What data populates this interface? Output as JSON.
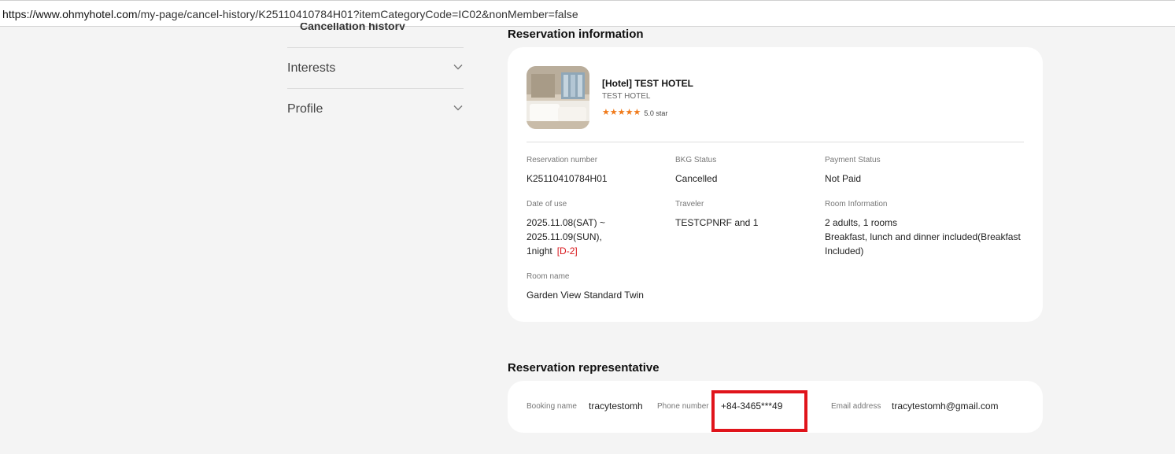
{
  "browser": {
    "url_host": "https://www.ohmyhotel.com",
    "url_path": "/my-page/cancel-history/K25110410784H01?itemCategoryCode=IC02&nonMember=false"
  },
  "sidebar": {
    "partial_item": "Cancellation history",
    "items": [
      {
        "label": "Interests",
        "icon": "chevron-down-icon"
      },
      {
        "label": "Profile",
        "icon": "chevron-down-icon"
      }
    ]
  },
  "reservation_info": {
    "title": "Reservation information",
    "hotel": {
      "name": "[Hotel] TEST HOTEL",
      "sub": "TEST HOTEL",
      "stars": 5,
      "rating": "5.0 star",
      "star_color": "#f07a1a"
    },
    "fields": {
      "reservation_number": {
        "label": "Reservation number",
        "value": "K25110410784H01"
      },
      "bkg_status": {
        "label": "BKG Status",
        "value": "Cancelled"
      },
      "payment_status": {
        "label": "Payment Status",
        "value": "Not Paid"
      },
      "date_of_use": {
        "label": "Date of use",
        "line1": "2025.11.08(SAT) ~",
        "line2": "2025.11.09(SUN),",
        "line3": "1night",
        "dday": "[D-2]"
      },
      "traveler": {
        "label": "Traveler",
        "value": "TESTCPNRF and 1"
      },
      "room_information": {
        "label": "Room Information",
        "line1": "2 adults, 1 rooms",
        "line2": "Breakfast, lunch and dinner included(Breakfast",
        "line3": "Included)"
      },
      "room_name": {
        "label": "Room name",
        "value": "Garden View Standard Twin"
      }
    }
  },
  "representative": {
    "title": "Reservation representative",
    "booking_name": {
      "label": "Booking name",
      "value": "tracytestomh"
    },
    "phone": {
      "label": "Phone number",
      "value": "+84-3465***49"
    },
    "email": {
      "label": "Email address",
      "value": "tracytestomh@gmail.com"
    }
  },
  "colors": {
    "accent_red": "#e0141b",
    "dday_red": "#d8161b"
  }
}
